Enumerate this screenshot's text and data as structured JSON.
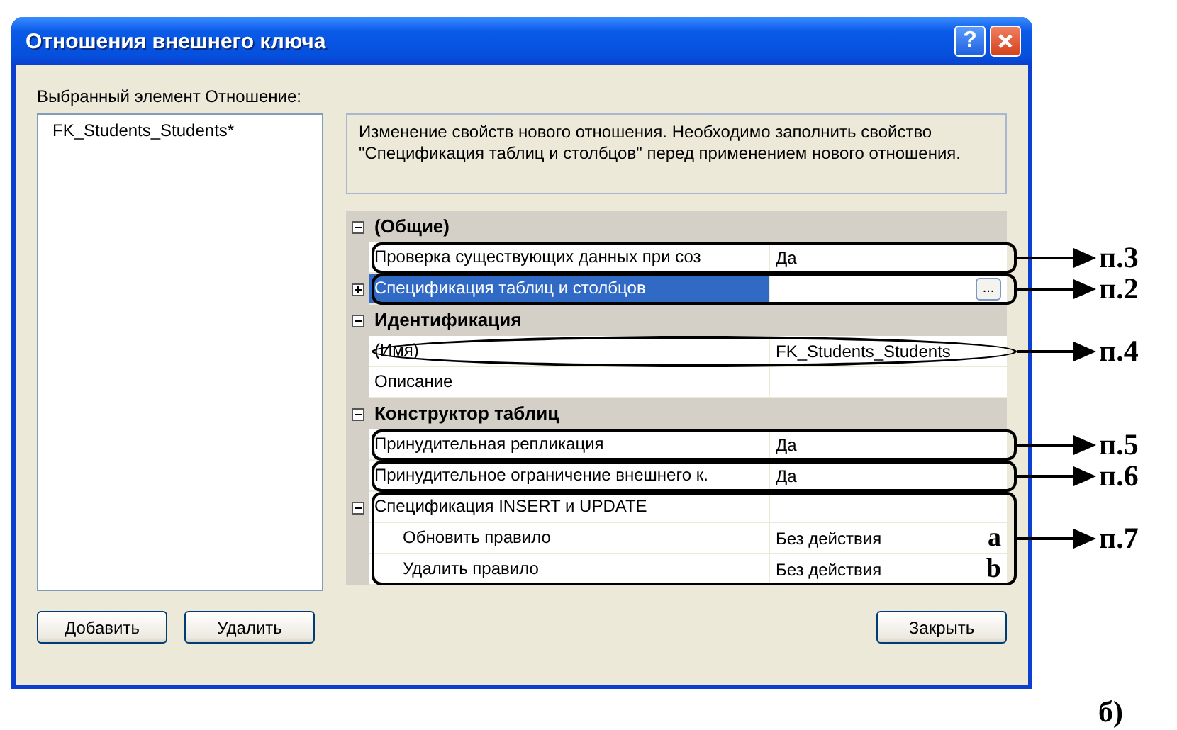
{
  "window": {
    "title": "Отношения внешнего ключа"
  },
  "title_buttons": [
    {
      "kind": "help",
      "label": "?"
    },
    {
      "kind": "close"
    }
  ],
  "relations_label": "Выбранный элемент Отношение:",
  "relations": [
    {
      "name": "FK_Students_Students*",
      "selected": false
    }
  ],
  "description": "Изменение свойств нового отношения.  Необходимо заполнить свойство \"Спецификация таблиц и столбцов\" перед применением нового отношения.",
  "properties": [
    {
      "kind": "category",
      "label": "(Общие)",
      "expanded": true,
      "selected": false
    },
    {
      "kind": "property",
      "name": "Проверка существующих данных при соз",
      "value": "Да",
      "selected": false,
      "callout": {
        "label": "п.3",
        "kind": "box"
      }
    },
    {
      "kind": "property",
      "name": "Спецификация таблиц и столбцов",
      "selected": true,
      "expanded": false,
      "button": "...",
      "callout": {
        "label": "п.2",
        "kind": "box"
      }
    },
    {
      "kind": "category",
      "label": "Идентификация",
      "expanded": true,
      "selected": false
    },
    {
      "kind": "property",
      "name": "(Имя)",
      "value": "FK_Students_Students",
      "selected": false,
      "callout": {
        "label": "п.4",
        "kind": "ellipse"
      }
    },
    {
      "kind": "property",
      "name": "Описание",
      "selected": false
    },
    {
      "kind": "category",
      "label": "Конструктор таблиц",
      "expanded": true,
      "selected": false
    },
    {
      "kind": "property",
      "name": "Принудительная репликация",
      "value": "Да",
      "selected": false,
      "callout": {
        "label": "п.5",
        "kind": "box"
      }
    },
    {
      "kind": "property",
      "name": "Принудительное ограничение внешнего к.",
      "value": "Да",
      "selected": false,
      "callout": {
        "label": "п.6",
        "kind": "box"
      }
    },
    {
      "kind": "property",
      "name": "Спецификация INSERT и UPDATE",
      "selected": false,
      "expanded": true,
      "callout": {
        "label": "п.7",
        "kind": "box"
      },
      "children": [
        {
          "kind": "property",
          "name": "Обновить правило",
          "value": "Без действия",
          "selected": false,
          "note": "a"
        },
        {
          "kind": "property",
          "name": "Удалить правило",
          "value": "Без действия",
          "selected": false,
          "note": "b"
        }
      ]
    }
  ],
  "left_buttons": [
    "Добавить",
    "Удалить"
  ],
  "close_button": "Закрыть",
  "caption": "б)"
}
